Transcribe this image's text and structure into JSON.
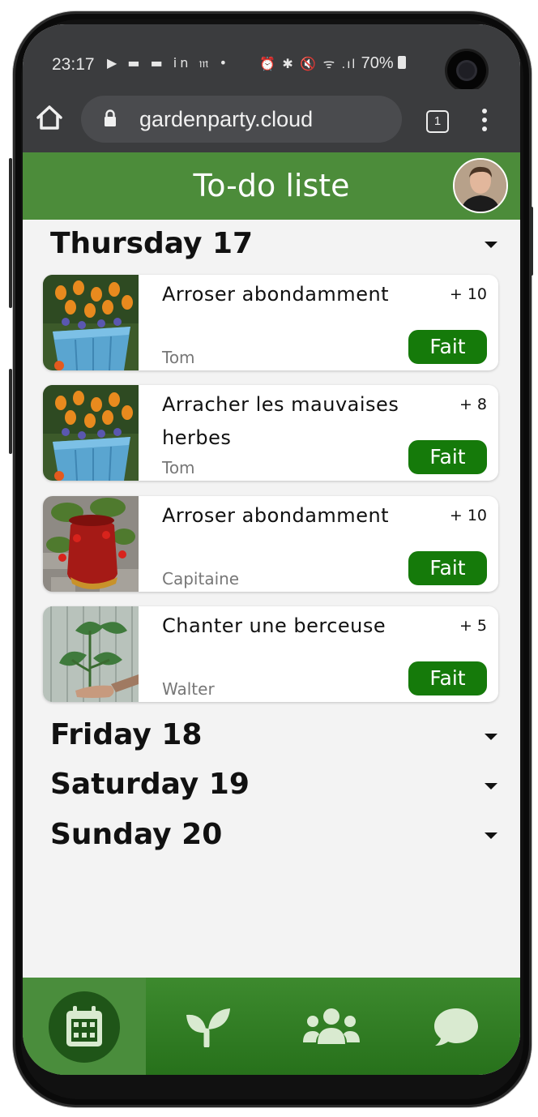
{
  "status_bar": {
    "time": "23:17",
    "notification_icons": "▶ ▬ ▬ in 𝔪 •",
    "system_icons": "⏰ ✱ 🔇 ᯤ .ıl",
    "battery": "70%"
  },
  "browser": {
    "url": "gardenparty.cloud",
    "tab_count": "1"
  },
  "header": {
    "title": "To-do liste"
  },
  "days": [
    {
      "label": "Thursday 17",
      "tasks": [
        {
          "title": "Arroser abondamment",
          "points": "+ 10",
          "assignee": "Tom",
          "action": "Fait",
          "image": "tulips-planter"
        },
        {
          "title": "Arracher les mauvaises herbes",
          "points": "+ 8",
          "assignee": "Tom",
          "action": "Fait",
          "image": "tulips-planter"
        },
        {
          "title": "Arroser abondamment",
          "points": "+ 10",
          "assignee": "Capitaine",
          "action": "Fait",
          "image": "strawberry-pot"
        },
        {
          "title": "Chanter une berceuse",
          "points": "+ 5",
          "assignee": "Walter",
          "action": "Fait",
          "image": "anthurium-plant"
        }
      ]
    },
    {
      "label": "Friday 18"
    },
    {
      "label": "Saturday 19"
    },
    {
      "label": "Sunday 20"
    }
  ],
  "bottom_nav": [
    {
      "name": "calendar-icon",
      "active": true
    },
    {
      "name": "sprout-icon",
      "active": false
    },
    {
      "name": "users-icon",
      "active": false
    },
    {
      "name": "chat-icon",
      "active": false
    }
  ],
  "colors": {
    "header_green": "#4c8c3a",
    "button_green": "#157a0a",
    "nav_green": "#3d8a2e",
    "background": "#f3f3f3"
  }
}
